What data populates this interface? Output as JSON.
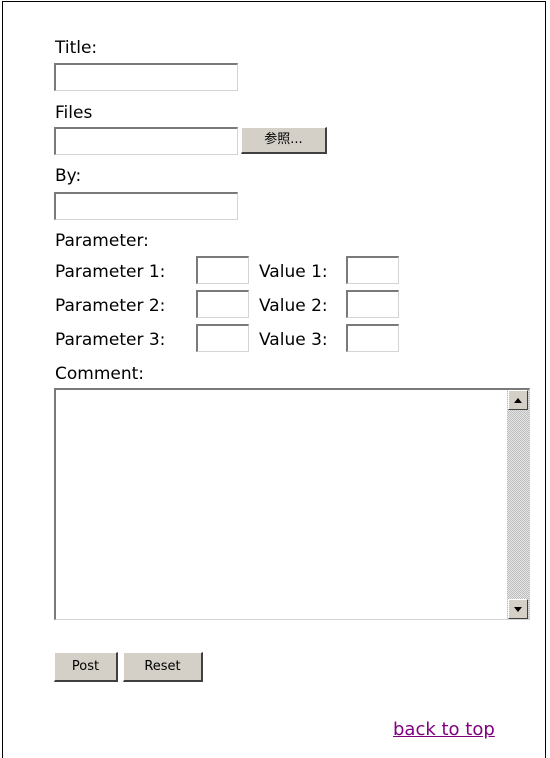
{
  "form": {
    "title_label": "Title:",
    "title_value": "",
    "files_label": "Files",
    "files_value": "",
    "browse_button": "参照...",
    "by_label": "By:",
    "by_value": "",
    "parameter_label": "Parameter:",
    "parameters": [
      {
        "param_label": "Parameter 1:",
        "param_value": "",
        "value_label": "Value 1:",
        "value_value": ""
      },
      {
        "param_label": "Parameter 2:",
        "param_value": "",
        "value_label": "Value 2:",
        "value_value": ""
      },
      {
        "param_label": "Parameter 3:",
        "param_value": "",
        "value_label": "Value 3:",
        "value_value": ""
      }
    ],
    "comment_label": "Comment:",
    "comment_value": "",
    "post_button": "Post",
    "reset_button": "Reset"
  },
  "footer": {
    "back_to_top": "back to top"
  },
  "colors": {
    "link_visited": "#800080",
    "button_face": "#d4d0c8"
  },
  "icons": {
    "scroll_up": "triangle-up-icon",
    "scroll_down": "triangle-down-icon"
  }
}
